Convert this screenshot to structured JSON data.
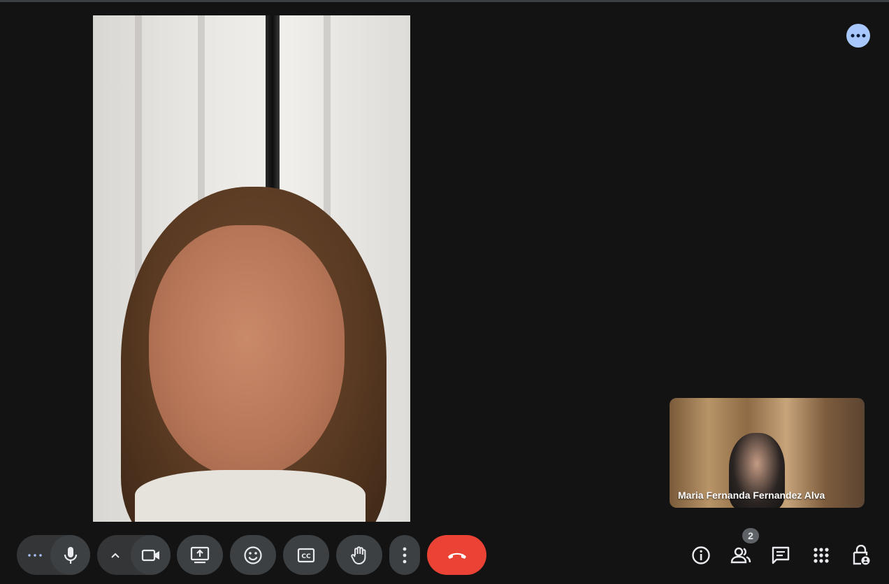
{
  "meeting": {
    "self_view_name": "Maria Fernanda Fernandez Alva",
    "participant_count": "2"
  },
  "icons": {
    "top_more": "more-horiz-icon",
    "mic_options": "more-horiz-icon",
    "mic": "mic-icon",
    "camera_options": "chevron-up-icon",
    "camera": "videocam-icon",
    "present": "present-screen-icon",
    "reactions": "emoji-icon",
    "captions": "closed-captions-icon",
    "raise_hand": "hand-icon",
    "more_options": "more-vert-icon",
    "leave": "call-end-icon",
    "info": "info-icon",
    "people": "people-icon",
    "chat": "chat-icon",
    "activities": "apps-grid-icon",
    "host_controls": "lock-person-icon"
  },
  "colors": {
    "background": "#131314",
    "control_bg": "#3c4043",
    "leave_red": "#ea4335",
    "accent_blue": "#a8c7fa",
    "icon_white": "#e8eaed"
  }
}
